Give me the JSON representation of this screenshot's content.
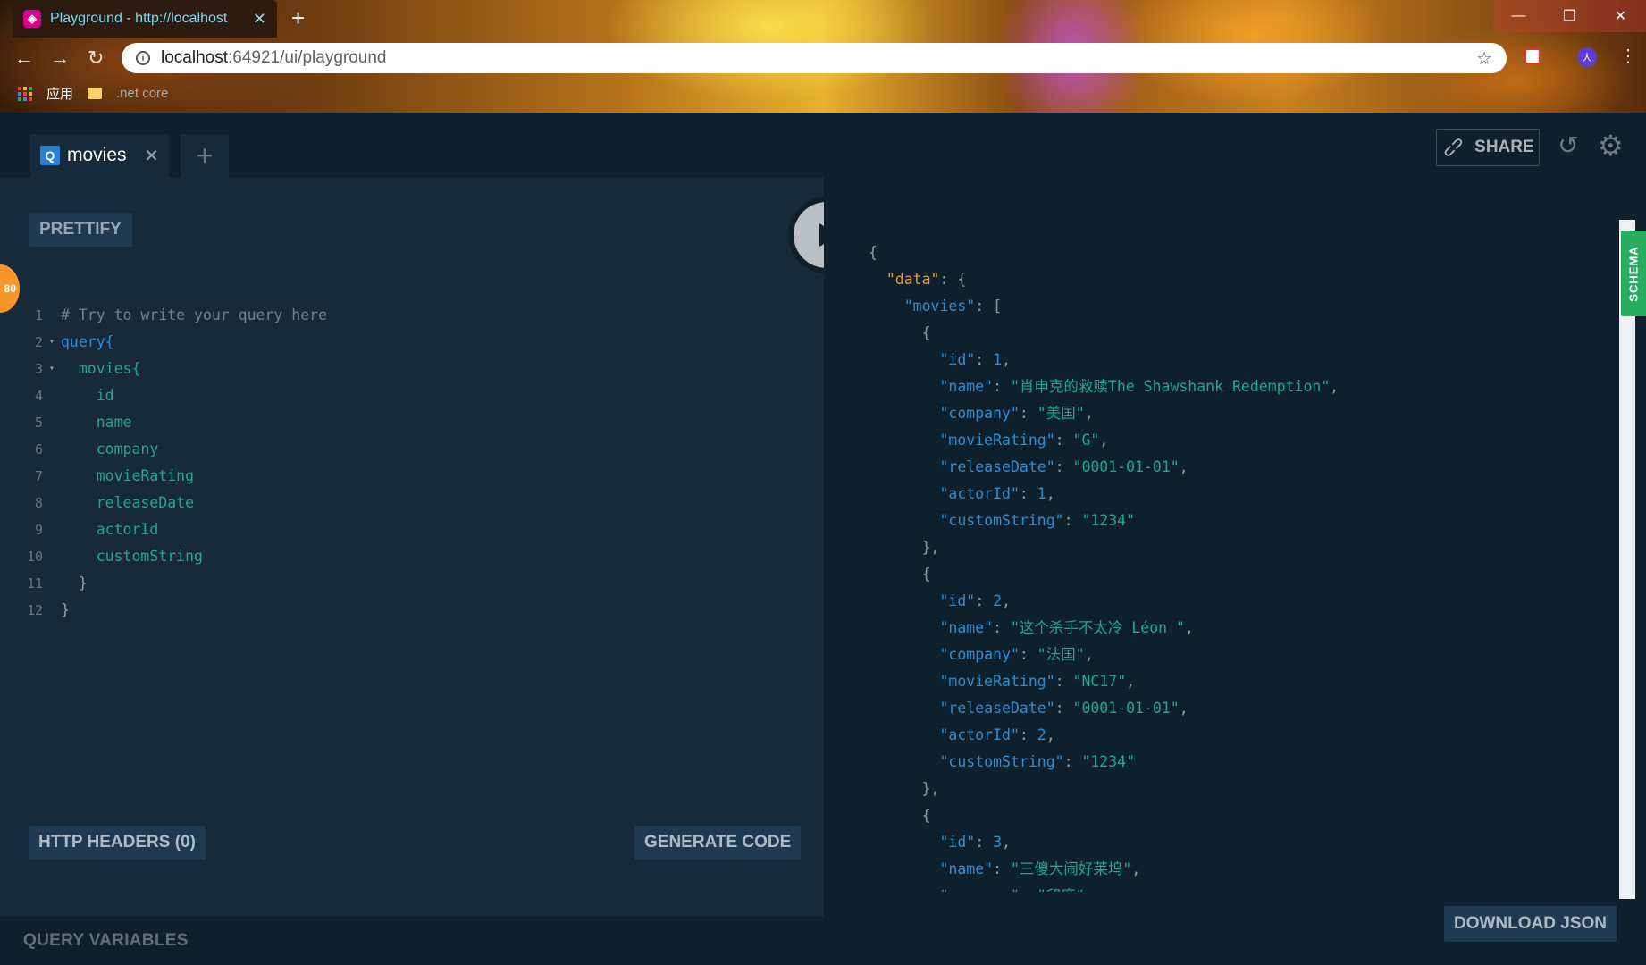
{
  "browser": {
    "tab_title": "Playground - http://localhost",
    "url_host": "localhost",
    "url_rest": ":64921/ui/playground",
    "bookmarks": [
      "应用",
      ".net core"
    ]
  },
  "playground": {
    "tab": {
      "badge": "Q",
      "name": "movies"
    },
    "share_label": "SHARE",
    "prettify_label": "PRETTIFY",
    "http_headers_label": "HTTP HEADERS (0)",
    "generate_code_label": "GENERATE CODE",
    "query_variables_label": "QUERY VARIABLES",
    "download_json_label": "DOWNLOAD JSON",
    "schema_label": "SCHEMA",
    "badge_count": "80",
    "query_lines": [
      {
        "n": "1",
        "fold": "",
        "indent": "",
        "text": "# Try to write your query here",
        "kind": "comment"
      },
      {
        "n": "2",
        "fold": "▾",
        "indent": "",
        "text": "query{",
        "kind": "kw"
      },
      {
        "n": "3",
        "fold": "▾",
        "indent": "  ",
        "text": "movies{",
        "kind": "fld"
      },
      {
        "n": "4",
        "fold": "",
        "indent": "    ",
        "text": "id",
        "kind": "fld"
      },
      {
        "n": "5",
        "fold": "",
        "indent": "    ",
        "text": "name",
        "kind": "fld"
      },
      {
        "n": "6",
        "fold": "",
        "indent": "    ",
        "text": "company",
        "kind": "fld"
      },
      {
        "n": "7",
        "fold": "",
        "indent": "    ",
        "text": "movieRating",
        "kind": "fld"
      },
      {
        "n": "8",
        "fold": "",
        "indent": "    ",
        "text": "releaseDate",
        "kind": "fld"
      },
      {
        "n": "9",
        "fold": "",
        "indent": "    ",
        "text": "actorId",
        "kind": "fld"
      },
      {
        "n": "10",
        "fold": "",
        "indent": "    ",
        "text": "customString",
        "kind": "fld"
      },
      {
        "n": "11",
        "fold": "",
        "indent": "  ",
        "text": "}",
        "kind": "brace"
      },
      {
        "n": "12",
        "fold": "",
        "indent": "",
        "text": "}",
        "kind": "brace"
      }
    ],
    "movies": [
      {
        "id": "1",
        "name": "肖申克的救赎The Shawshank Redemption",
        "company": "美国",
        "movieRating": "G",
        "releaseDate": "0001-01-01",
        "actorId": "1",
        "customString": "1234"
      },
      {
        "id": "2",
        "name": "这个杀手不太冷 Léon ",
        "company": "法国",
        "movieRating": "NC17",
        "releaseDate": "0001-01-01",
        "actorId": "2",
        "customString": "1234"
      },
      {
        "id": "3",
        "name": "三傻大闹好莱坞",
        "company": "印度"
      }
    ]
  }
}
